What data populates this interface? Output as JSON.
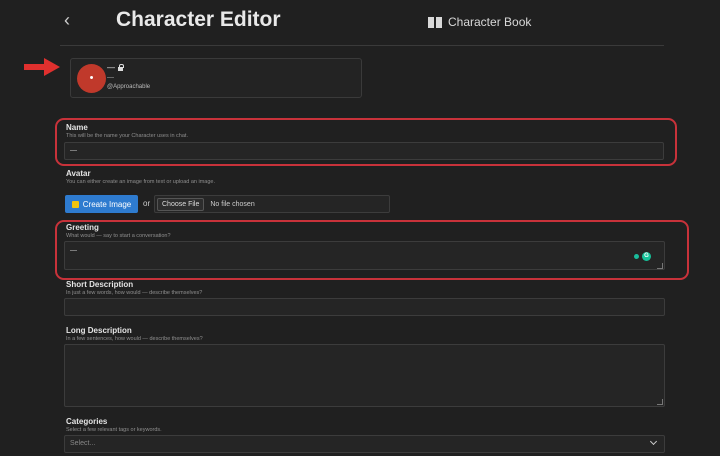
{
  "header": {
    "back_label": "‹",
    "title": "Character Editor",
    "book_label": "Character Book"
  },
  "profile": {
    "avatar_initial": "•",
    "name": "—",
    "subtitle": "—",
    "handle": "@Approachable"
  },
  "name_field": {
    "label": "Name",
    "hint": "This will be the name your Character uses in chat.",
    "value": "—"
  },
  "avatar_field": {
    "label": "Avatar",
    "hint": "You can either create an image from text or upload an image.",
    "create_button": "Create Image",
    "or_text": "or",
    "choose_file": "Choose File",
    "no_file": "No file chosen"
  },
  "greeting_field": {
    "label": "Greeting",
    "hint": "What would — say to start a conversation?",
    "value": "—"
  },
  "short_description": {
    "label": "Short Description",
    "hint": "In just a few words, how would — describe themselves?",
    "value": ""
  },
  "long_description": {
    "label": "Long Description",
    "hint": "In a few sentences, how would — describe themselves?",
    "value": ""
  },
  "categories": {
    "label": "Categories",
    "hint": "Select a few relevant tags or keywords.",
    "placeholder": "Select..."
  },
  "colors": {
    "background": "#202020",
    "highlight": "#c8323a",
    "accent_button": "#2e7bcf",
    "avatar": "#c0392b"
  }
}
